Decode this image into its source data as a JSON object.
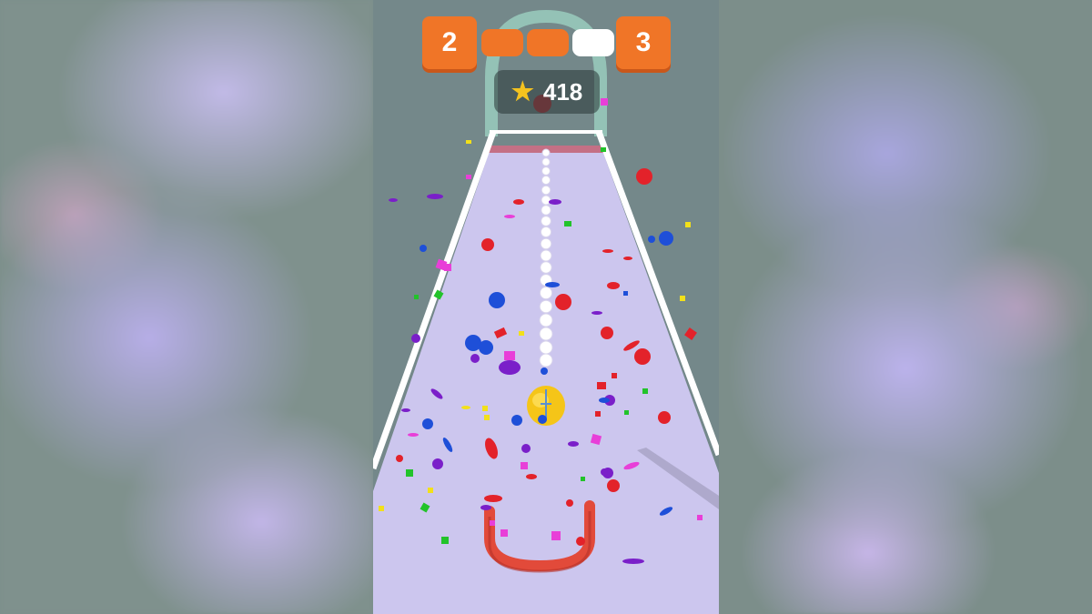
{
  "hud": {
    "current_level": "2",
    "next_level": "3",
    "stage_progress": {
      "completed": 2,
      "total": 3
    },
    "score": "418"
  },
  "colors": {
    "hud_orange": "#f07527",
    "progress_empty": "#ffffff",
    "track": "#ccc6ee",
    "confetti": [
      "#e3222a",
      "#1e4fd8",
      "#7a1fc9",
      "#e83fd8",
      "#22c32a",
      "#f2e01a"
    ]
  },
  "icons": [
    "star-icon",
    "ball-icon",
    "hoop-icon"
  ]
}
